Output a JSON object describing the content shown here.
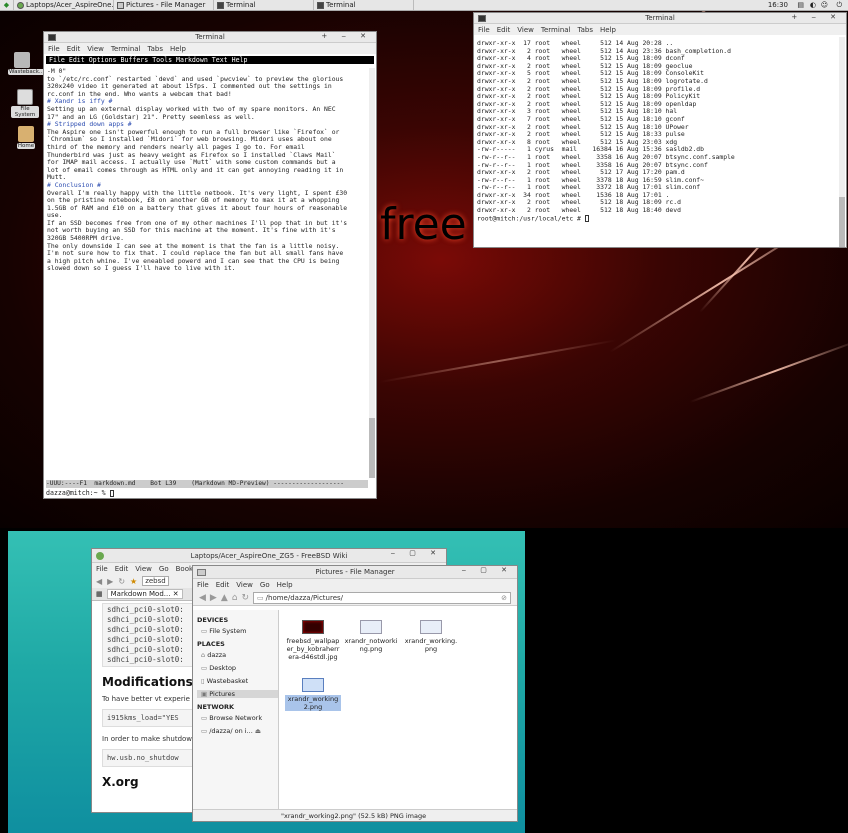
{
  "panel": {
    "tasks": [
      "Laptops/Acer_AspireOne...",
      "Pictures - File Manager",
      "Terminal",
      "Terminal"
    ],
    "clock": "16:30"
  },
  "desktop_icons": [
    {
      "label": "Wasteback..."
    },
    {
      "label": "File System"
    },
    {
      "label": "Home"
    }
  ],
  "wallpaper_text": "free",
  "term1": {
    "title": "Terminal",
    "menu": [
      "File",
      "Edit",
      "View",
      "Terminal",
      "Tabs",
      "Help"
    ],
    "emacs_menu": "File Edit Options Buffers Tools Markdown Text Help",
    "lines": [
      "-M 0\"",
      "",
      "to `/etc/rc.conf` restarted `devd` and used `pwcview` to preview the glorious",
      "320x240 video it generated at about 15fps. I commented out the settings in",
      "rc.conf in the end. Who wants a webcam that bad!",
      "",
      "# Xandr is iffy #",
      "Setting up an external display worked with two of my spare monitors. An NEC",
      "17\" and an LG (Goldstar) 21\". Pretty seemless as well.",
      "",
      "# Stripped down apps #",
      "The Aspire one isn't powerful enough to run a full browser like `Firefox` or",
      "`Chromium` so I installed `Midori` for web browsing. Midori uses about one",
      "third of the memory and renders nearly all pages I go to. For email",
      "Thunderbird was just as heavy weight as Firefox so I installed `Claws Mail`",
      "for IMAP mail access. I actually use `Mutt` with some custom commands but a",
      "lot of email comes through as HTML only and it can get annoying reading it in",
      "Mutt.",
      "",
      "# Conclusion #",
      "Overall I'm really happy with the little netbook. It's very light, I spent £30",
      "on the pristine notebook, £8 on another GB of memory to max it at a whopping",
      "1.5GB of RAM and £10 on a battery that gives it about four hours of reasonable",
      "use.",
      "",
      "If an SSD becomes free from one of my other machines I'll pop that in but it's",
      "not worth buying an SSD for this machine at the moment. It's fine with it's",
      "320GB 5400RPM drive.",
      "",
      "The only downside I can see at the moment is that the fan is a little noisy.",
      "I'm not sure how to fix that. I could replace the fan but all small fans have",
      "a high pitch whine. I've eneabled powerd and I can see that the CPU is being",
      "slowed down so I guess I'll have to live with it."
    ],
    "modeline": "-UUU:----F1  markdown.md    Bot L39    (Markdown MD-Preview) -------------------",
    "prompt": "dazza@mitch:~ % "
  },
  "term2": {
    "title": "Terminal",
    "menu": [
      "File",
      "Edit",
      "View",
      "Terminal",
      "Tabs",
      "Help"
    ],
    "lines": [
      "drwxr-xr-x  17 root   wheel     512 14 Aug 20:28 ..",
      "drwxr-xr-x   2 root   wheel     512 14 Aug 23:36 bash_completion.d",
      "drwxr-xr-x   4 root   wheel     512 15 Aug 18:09 dconf",
      "drwxr-xr-x   2 root   wheel     512 15 Aug 18:09 geoclue",
      "drwxr-xr-x   5 root   wheel     512 15 Aug 18:09 ConsoleKit",
      "drwxr-xr-x   2 root   wheel     512 15 Aug 18:09 logrotate.d",
      "drwxr-xr-x   2 root   wheel     512 15 Aug 18:09 profile.d",
      "drwxr-xr-x   2 root   wheel     512 15 Aug 18:09 PolicyKit",
      "drwxr-xr-x   2 root   wheel     512 15 Aug 18:09 openldap",
      "drwxr-xr-x   3 root   wheel     512 15 Aug 18:10 hal",
      "drwxr-xr-x   7 root   wheel     512 15 Aug 18:10 gconf",
      "drwxr-xr-x   2 root   wheel     512 15 Aug 18:10 UPower",
      "drwxr-xr-x   2 root   wheel     512 15 Aug 18:33 pulse",
      "drwxr-xr-x   8 root   wheel     512 15 Aug 23:03 xdg",
      "-rw-r-----   1 cyrus  mail    16384 16 Aug 15:36 sasldb2.db",
      "-rw-r--r--   1 root   wheel    3358 16 Aug 20:07 btsync.conf.sample",
      "-rw-r--r--   1 root   wheel    3358 16 Aug 20:07 btsync.conf",
      "drwxr-xr-x   2 root   wheel     512 17 Aug 17:20 pam.d",
      "-rw-r--r--   1 root   wheel    3378 18 Aug 16:59 slim.conf~",
      "-rw-r--r--   1 root   wheel    3372 18 Aug 17:01 slim.conf",
      "drwxr-xr-x  34 root   wheel    1536 18 Aug 17:01 .",
      "drwxr-xr-x   2 root   wheel     512 18 Aug 18:09 rc.d",
      "drwxr-xr-x   2 root   wheel     512 18 Aug 18:40 devd"
    ],
    "prompt": "root@mitch:/usr/local/etc # "
  },
  "browser": {
    "title": "Laptops/Acer_AspireOne_ZG5 - FreeBSD Wiki",
    "menu": [
      "File",
      "Edit",
      "View",
      "Go",
      "Bookm"
    ],
    "tabs": [
      "Markdown Mod...",
      "zebsd"
    ],
    "code_lines": [
      "sdhci_pci0-slot0:",
      "sdhci_pci0-slot0:",
      "sdhci_pci0-slot0:",
      "sdhci_pci0-slot0:",
      "sdhci_pci0-slot0:",
      "sdhci_pci0-slot0:"
    ],
    "heading": "Modifications",
    "para1": "To have better vt experie",
    "code1": "i915kms_load=\"YES",
    "para2": "In order to make shutdow",
    "code2": "hw.usb.no_shutdow",
    "heading2": "X.org"
  },
  "filemanager": {
    "title": "Pictures - File Manager",
    "menu": [
      "File",
      "Edit",
      "View",
      "Go",
      "Help"
    ],
    "path": "/home/dazza/Pictures/",
    "devices_header": "DEVICES",
    "devices": [
      "File System"
    ],
    "places_header": "PLACES",
    "places": [
      "dazza",
      "Desktop",
      "Wastebasket",
      "Pictures"
    ],
    "network_header": "NETWORK",
    "network": [
      "Browse Network",
      "/dazza/ on i..."
    ],
    "files": [
      {
        "name": "freebsd_wallpaper_by_kobraherrera-d46stdl.jpg",
        "kind": "dark"
      },
      {
        "name": "xrandr_notworking.png",
        "kind": "shot"
      },
      {
        "name": "xrandr_working.png",
        "kind": "shot"
      },
      {
        "name": "xrandr_working2.png",
        "kind": "shot"
      }
    ],
    "status": "\"xrandr_working2.png\" (52.5 kB) PNG image"
  }
}
